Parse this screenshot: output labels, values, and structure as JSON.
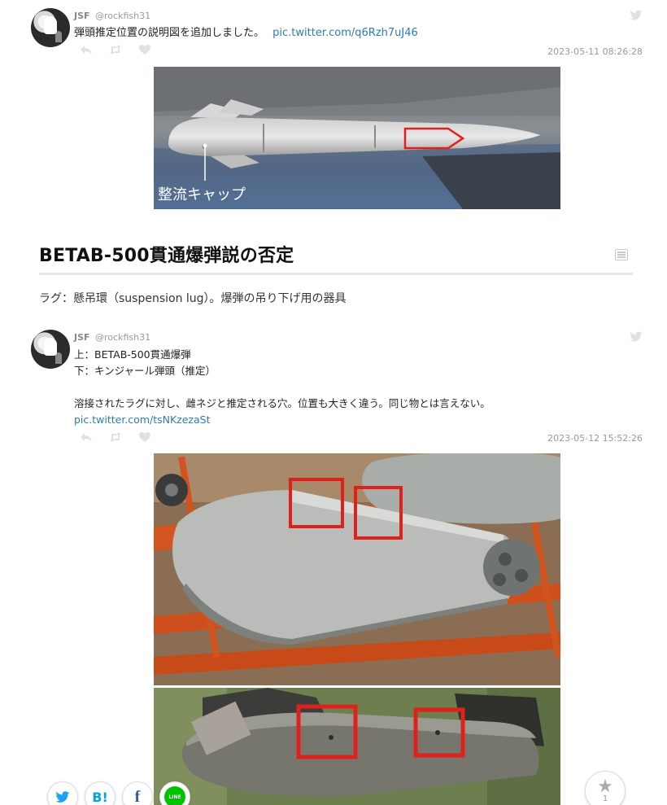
{
  "tweets": [
    {
      "name": "JSF",
      "handle": "@rockfish31",
      "text": "弾頭推定位置の説明図を追加しました。",
      "link": "pic.twitter.com/q6Rzh7uJ46",
      "timestamp": "2023-05-11 08:26:28",
      "photo_caption": "整流キャップ"
    },
    {
      "name": "JSF",
      "handle": "@rockfish31",
      "line1": "上：BETAB-500貫通爆弾",
      "line2": "下：キンジャール弾頭（推定）",
      "line3": "溶接されたラグに対し、雌ネジと推定される穴。位置も大きく違う。同じ物とは言えない。",
      "link": "pic.twitter.com/tsNKzezaSt",
      "timestamp": "2023-05-12 15:52:26"
    }
  ],
  "section": {
    "title": "BETAB-500貫通爆弾説の否定"
  },
  "paragraph": "ラグ：懸吊環（suspension lug）。爆弾の吊り下げ用の器具",
  "share": {
    "hatena_label": "B!",
    "facebook_label": "f",
    "line_label": "LINE",
    "star_count": "1"
  },
  "colors": {
    "link": "#2b7bb9",
    "twitter": "#1da1f2",
    "hatena": "#00a4de",
    "facebook": "#3b5998",
    "line": "#00c300",
    "highlight": "#e0211b"
  }
}
